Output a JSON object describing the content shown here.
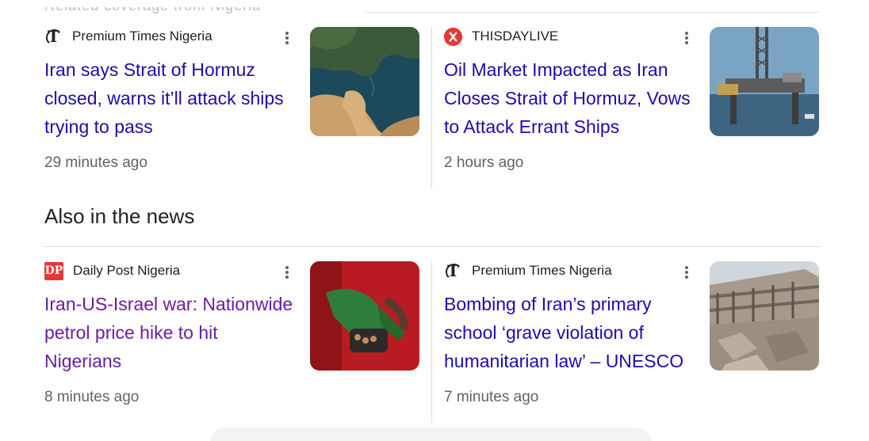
{
  "top_section": {
    "partial_heading": "Related coverage from Nigeria"
  },
  "top_stories": [
    {
      "source": "Premium Times Nigeria",
      "logo_icon": "premium-times-t-logo",
      "headline": "Iran says Strait of Hormuz closed, warns it’ll attack ships trying to pass",
      "time": "29 minutes ago",
      "thumbnail": "strait-of-hormuz-satellite-map",
      "visited": false
    },
    {
      "source": "THISDAYLIVE",
      "logo_icon": "thisdaylive-logo",
      "headline": "Oil Market Impacted as Iran Closes Strait of Hormuz, Vows to Attack Errant Ships",
      "time": "2 hours ago",
      "thumbnail": "offshore-oil-rig-photo",
      "visited": false
    }
  ],
  "also_in_the_news": {
    "heading": "Also in the news",
    "stories": [
      {
        "source": "Daily Post Nigeria",
        "logo_icon": "daily-post-dp-logo",
        "headline": "Iran-US-Israel war: Nationwide petrol price hike to hit Nigerians",
        "time": "8 minutes ago",
        "thumbnail": "fuel-pump-nozzle-photo",
        "visited": true
      },
      {
        "source": "Premium Times Nigeria",
        "logo_icon": "premium-times-t-logo",
        "headline": "Bombing of Iran’s primary school ‘grave violation of humanitarian law’ – UNESCO",
        "time": "7 minutes ago",
        "thumbnail": "collapsed-building-rubble-photo",
        "visited": false
      }
    ]
  },
  "colors": {
    "link": "#1a0dab",
    "visited_link": "#681da8",
    "meta_text": "#5f6368",
    "divider": "#dadce0",
    "brand_red": "#e53935"
  }
}
